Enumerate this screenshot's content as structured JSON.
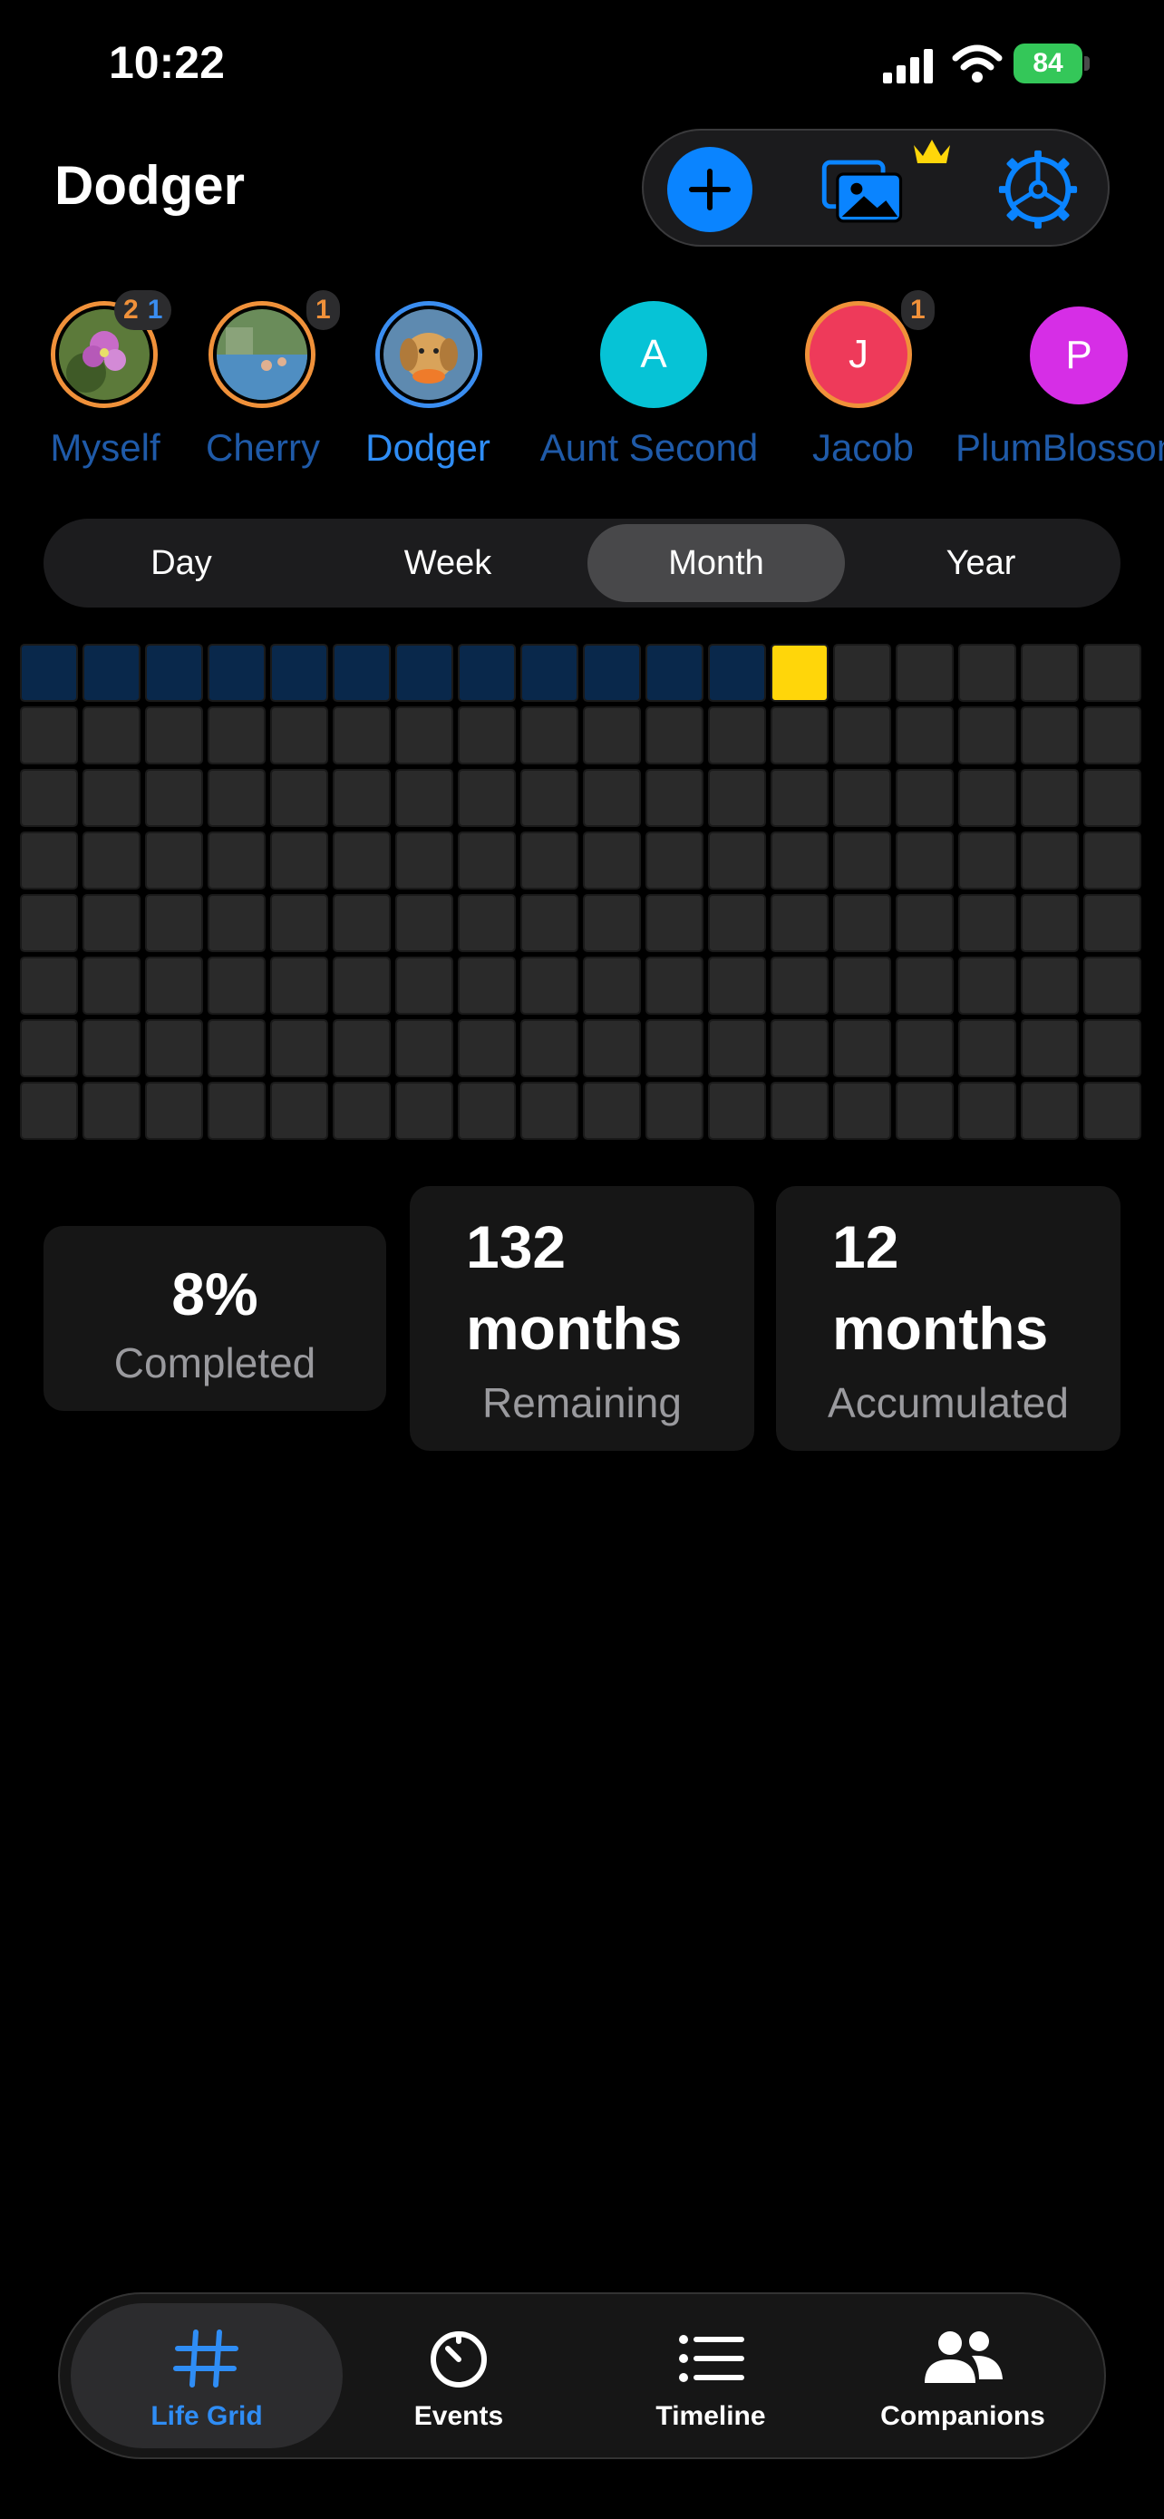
{
  "status_bar": {
    "time": "10:22",
    "battery": "84"
  },
  "header": {
    "title": "Dodger"
  },
  "colors": {
    "accent": "#0a84ff",
    "past_cell": "#09284b",
    "current_cell": "#ffd60a",
    "empty_cell": "#2a2a2a"
  },
  "profiles": [
    {
      "name": "Myself",
      "badge_orange": "2",
      "badge_blue": "1",
      "initial": ""
    },
    {
      "name": "Cherry",
      "badge_orange": "1",
      "badge_blue": "",
      "initial": ""
    },
    {
      "name": "Dodger",
      "badge_orange": "",
      "badge_blue": "",
      "initial": ""
    },
    {
      "name": "Aunt Second",
      "badge_orange": "",
      "badge_blue": "",
      "initial": "A"
    },
    {
      "name": "Jacob",
      "badge_orange": "1",
      "badge_blue": "",
      "initial": "J"
    },
    {
      "name": "PlumBlossom",
      "badge_orange": "",
      "badge_blue": "",
      "initial": "P"
    }
  ],
  "segments": [
    "Day",
    "Week",
    "Month",
    "Year"
  ],
  "selected_segment": "Month",
  "life_grid": {
    "columns": 18,
    "rows": 8,
    "filled": 12,
    "current": 13
  },
  "stats": {
    "completed": {
      "value": "8%",
      "label": "Completed"
    },
    "remaining": {
      "value_line1": "132",
      "value_line2": "months",
      "label": "Remaining"
    },
    "accumulated": {
      "value_line1": "12",
      "value_line2": "months",
      "label": "Accumulated"
    }
  },
  "tabs": [
    {
      "label": "Life Grid",
      "icon": "hash-grid-icon"
    },
    {
      "label": "Events",
      "icon": "timer-icon"
    },
    {
      "label": "Timeline",
      "icon": "list-icon"
    },
    {
      "label": "Companions",
      "icon": "people-icon"
    }
  ]
}
